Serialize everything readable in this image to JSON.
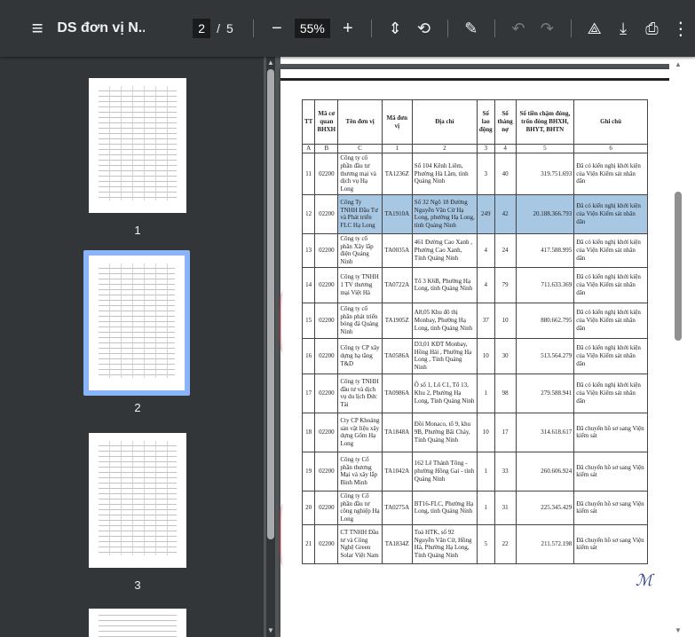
{
  "toolbar": {
    "menu_icon": "≡",
    "title": "DS đơn vị N...",
    "current_page": "2",
    "page_separator": "/",
    "total_pages": "5",
    "zoom_out_icon": "−",
    "zoom_level": "55%",
    "zoom_in_icon": "+",
    "fit_icon": "⇕",
    "rotate_icon": "⟲",
    "draw_icon": "✎",
    "undo_icon": "↶",
    "redo_icon": "↷",
    "save_drive_icon": "⟁",
    "download_icon": "⤓",
    "print_icon": "⎙",
    "more_icon": "⋮"
  },
  "sidebar": {
    "thumbnails": [
      {
        "label": "1"
      },
      {
        "label": "2"
      },
      {
        "label": "3"
      }
    ]
  },
  "document": {
    "headers": {
      "tt": "TT",
      "ma_co_quan": "Mã cơ quan BHXH",
      "ten_don_vi": "Tên đơn vị",
      "ma_don_vi": "Mã đơn vị",
      "dia_chi": "Địa chỉ",
      "so_lao_dong": "Số lao động",
      "so_thang_no": "Số tháng nợ",
      "so_tien": "Số tiền chậm đóng, trốn đóng BHXH, BHYT, BHTN",
      "ghi_chu": "Ghi chú"
    },
    "letters": [
      "A",
      "B",
      "C",
      "1",
      "2",
      "3",
      "4",
      "5",
      "6"
    ],
    "rows": [
      {
        "tt": "11",
        "ma_cq": "02200",
        "ten": "Công ty cổ phần đầu tư thương mại và dịch vụ Hạ Long",
        "ma_dv": "TA1236Z",
        "dia_chi": "Số 104 Kênh Liêm, Phường Hà Lầm, tỉnh Quảng Ninh",
        "lao_dong": "3",
        "thang_no": "40",
        "so_tien": "319.751.693",
        "ghi_chu": "Đã có kiến nghị khởi kiện của Viện Kiểm sát nhân dân"
      },
      {
        "tt": "12",
        "ma_cq": "02200",
        "ten": "Công Ty TNHH Đầu Tư và Phát triển FLC Hạ Long",
        "ma_dv": "TA1910A",
        "dia_chi": "Số 32 Ngõ 18 Đường Nguyễn Văn Cừ Hạ Long, phường Hạ Long, tỉnh Quảng Ninh",
        "lao_dong": "249",
        "thang_no": "42",
        "so_tien": "20.188.366.793",
        "ghi_chu": "Đã có kiến nghị khởi kiện của Viện Kiểm sát nhân dân"
      },
      {
        "tt": "13",
        "ma_cq": "02200",
        "ten": "Công ty cổ phần Xây lắp điện Quảng Ninh",
        "ma_dv": "TA0035A",
        "dia_chi": "461 Đường Cao Xanh , Phường Cao Xanh, Tỉnh Quảng Ninh",
        "lao_dong": "4",
        "thang_no": "24",
        "so_tien": "417.588.995",
        "ghi_chu": "Đã có kiến nghị khởi kiện của Viện Kiểm sát nhân dân"
      },
      {
        "tt": "14",
        "ma_cq": "02200",
        "ten": "Công ty TNHH 1 TV thương mại Việt Hà",
        "ma_dv": "TA0722A",
        "dia_chi": "Tổ 3 K6B, Phường Hạ Long, tỉnh Quảng Ninh",
        "lao_dong": "4",
        "thang_no": "79",
        "so_tien": "711.633.369",
        "ghi_chu": "Đã có kiến nghị khởi kiện của Viện Kiểm sát nhân dân"
      },
      {
        "tt": "15",
        "ma_cq": "02200",
        "ten": "Công ty cổ phần phát triển bóng đá Quảng Ninh",
        "ma_dv": "TA1905Z",
        "dia_chi": "A8,05 Khu đô thị Monbay, Phường Hạ Long, tỉnh Quảng Ninh",
        "lao_dong": "37",
        "thang_no": "10",
        "so_tien": "880.662.795",
        "ghi_chu": "Đã có kiến nghị khởi kiện của Viện Kiểm sát nhân dân"
      },
      {
        "tt": "16",
        "ma_cq": "02200",
        "ten": "Công ty CP xây dựng hạ tầng T&D",
        "ma_dv": "TA0586A",
        "dia_chi": "D3,01 KĐT Monbay, Hồng Hải , Phường Hạ Long , Tỉnh Quảng Ninh",
        "lao_dong": "10",
        "thang_no": "30",
        "so_tien": "513.564.279",
        "ghi_chu": "Đã có kiến nghị khởi kiện của Viện Kiểm sát nhân dân"
      },
      {
        "tt": "17",
        "ma_cq": "02200",
        "ten": "Công ty TNHH đầu tư và dịch vụ du lịch Đức Tài",
        "ma_dv": "TA0986A",
        "dia_chi": "Ô số 1, Lô C1, Tổ 13, Khu 2, Phường Hạ Long, Tỉnh Quảng Ninh",
        "lao_dong": "1",
        "thang_no": "98",
        "so_tien": "279.588.941",
        "ghi_chu": "Đã có kiến nghị khởi kiện của Viện Kiểm sát nhân dân"
      },
      {
        "tt": "18",
        "ma_cq": "02200",
        "ten": "Cty CP Khoáng sản vật liệu xây dựng Gốm Hạ Long",
        "ma_dv": "TA1848A",
        "dia_chi": "Đồi Monaco, tổ 9, khu 9B, Phường Bãi Cháy, Tỉnh Quảng Ninh",
        "lao_dong": "10",
        "thang_no": "17",
        "so_tien": "314.618.617",
        "ghi_chu": "Đã chuyển hồ sơ sang Viện kiểm sát"
      },
      {
        "tt": "19",
        "ma_cq": "02200",
        "ten": "Công ty Cổ phần thương Mại và xây lắp Bình Minh",
        "ma_dv": "TA1042A",
        "dia_chi": "162 Lê Thánh Tông - phường Hồng Gai - tỉnh Quảng Ninh",
        "lao_dong": "1",
        "thang_no": "33",
        "so_tien": "260.606.924",
        "ghi_chu": "Đã chuyển hồ sơ sang Viện kiểm sát"
      },
      {
        "tt": "20",
        "ma_cq": "02200",
        "ten": "Công ty Cổ phần đầu tư công nghiệp Hạ Long",
        "ma_dv": "TA0275A",
        "dia_chi": "BT16-FLC, Phường Hạ Long, tỉnh Quảng Ninh",
        "lao_dong": "1",
        "thang_no": "31",
        "so_tien": "225.345.429",
        "ghi_chu": "Đã chuyển hồ sơ sang Viện kiểm sát"
      },
      {
        "tt": "21",
        "ma_cq": "02200",
        "ten": "CT TNHH Đầu tư và Công Nghệ Green Solar Việt Nam",
        "ma_dv": "TA1834Z",
        "dia_chi": "Toà HTK, số 92 Nguyễn Văn Cừ, Hồng Hà, Phường Hạ Long, Tỉnh Quảng Ninh",
        "lao_dong": "5",
        "thang_no": "22",
        "so_tien": "211.572.198",
        "ghi_chu": "Đã chuyển hồ sơ sang Viện kiểm sát"
      }
    ],
    "highlighted_row": 1,
    "signature": "ℳ"
  },
  "colors": {
    "toolbar_bg": "#323639",
    "viewer_bg": "#525659",
    "selection": "#8ab4f8",
    "text_highlight": "#a8c7e3"
  }
}
